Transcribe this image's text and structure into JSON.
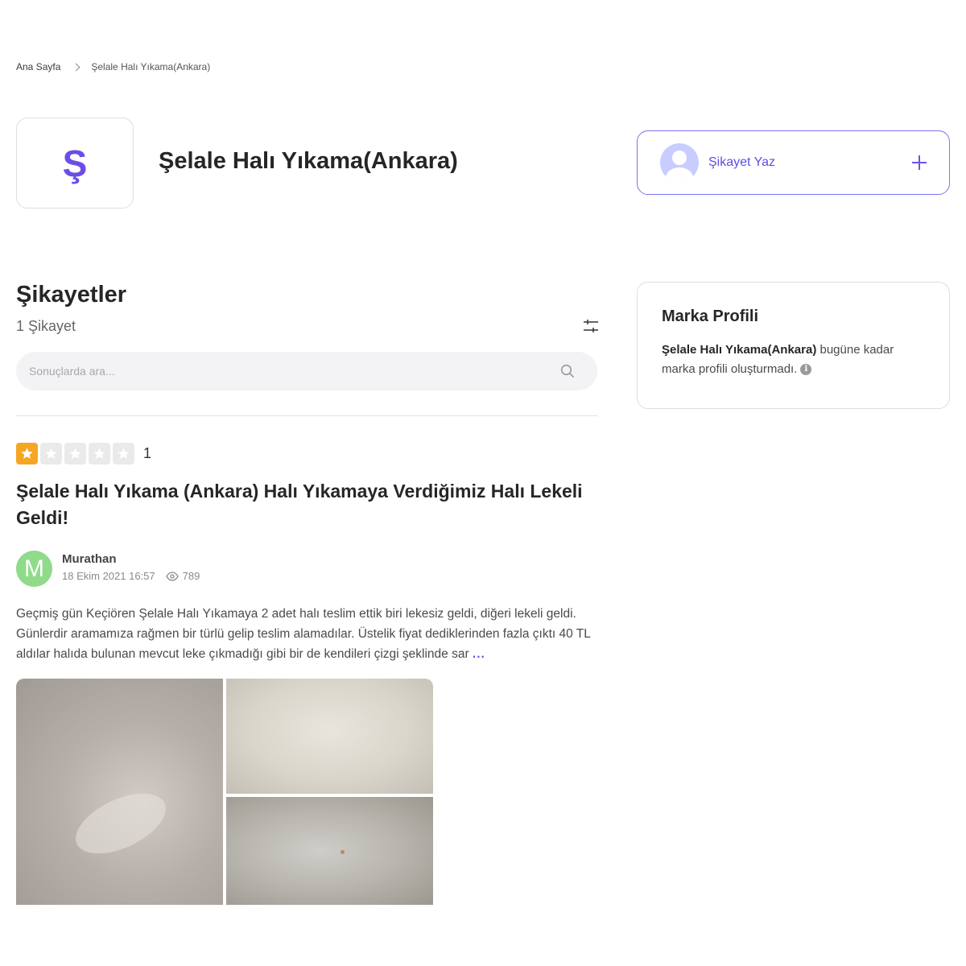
{
  "breadcrumb": {
    "home": "Ana Sayfa",
    "current": "Şelale Halı Yıkama(Ankara)"
  },
  "brand": {
    "logo_letter": "Ş",
    "name": "Şelale Halı Yıkama(Ankara)"
  },
  "write_complaint": {
    "label": "Şikayet Yaz"
  },
  "complaints": {
    "title": "Şikayetler",
    "count": "1 Şikayet",
    "search_placeholder": "Sonuçlarda ara...",
    "items": [
      {
        "rating": {
          "value": 1,
          "max": 5,
          "label": "1"
        },
        "title": "Şelale Halı Yıkama (Ankara) Halı Yıkamaya Verdiğimiz Halı Lekeli Geldi!",
        "user": {
          "initial": "M",
          "name": "Murathan"
        },
        "date": "18 Ekim 2021 16:57",
        "views": "789",
        "text": "Geçmiş gün Keçiören Şelale Halı Yıkamaya 2 adet halı teslim ettik biri lekesiz geldi, diğeri lekeli geldi. Günlerdir aramamıza rağmen bir türlü gelip teslim alamadılar. Üstelik fiyat dediklerinden fazla çıktı 40 TL aldılar halıda bulunan mevcut leke çıkmadığı gibi bir de kendileri çizgi şeklinde sar",
        "more": "..."
      }
    ]
  },
  "profile_card": {
    "title": "Marka Profili",
    "brand_name": "Şelale Halı Yıkama(Ankara)",
    "text": " bugüne kadar marka profili oluşturmadı.",
    "info": "i"
  },
  "colors": {
    "accent": "#6a55e8",
    "star": "#f5a623",
    "user_avatar": "#8fdb8a"
  },
  "icons": [
    "chevron-right-icon",
    "user-placeholder-icon",
    "plus-icon",
    "filter-icon",
    "search-icon",
    "star-icon",
    "eye-icon",
    "info-icon"
  ]
}
